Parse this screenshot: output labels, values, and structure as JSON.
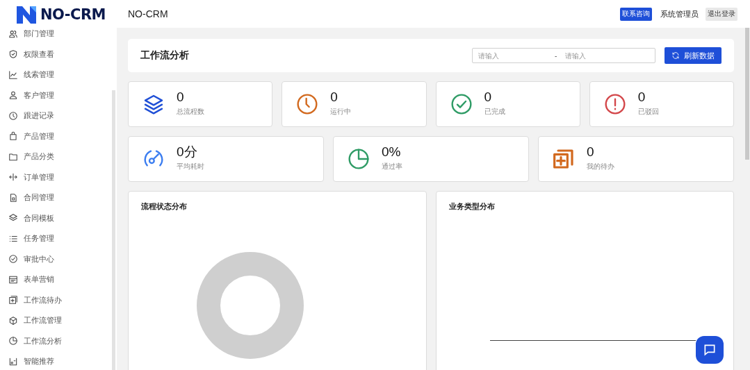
{
  "brand": {
    "logo_text": "NO-CRM"
  },
  "header": {
    "title": "NO-CRM",
    "contact_button": "联系咨询",
    "user": "系统管理员",
    "logout_button": "退出登录"
  },
  "sidebar": {
    "items": [
      {
        "label": "部门管理"
      },
      {
        "label": "权限查看"
      },
      {
        "label": "线索管理"
      },
      {
        "label": "客户管理"
      },
      {
        "label": "跟进记录"
      },
      {
        "label": "产品管理"
      },
      {
        "label": "产品分类"
      },
      {
        "label": "订单管理"
      },
      {
        "label": "合同管理"
      },
      {
        "label": "合同模板"
      },
      {
        "label": "任务管理"
      },
      {
        "label": "审批中心"
      },
      {
        "label": "表单营销"
      },
      {
        "label": "工作流待办"
      },
      {
        "label": "工作流管理"
      },
      {
        "label": "工作流分析"
      },
      {
        "label": "智能推荐"
      }
    ]
  },
  "page": {
    "title": "工作流分析",
    "date_range": {
      "start_placeholder": "请输入",
      "separator": "-",
      "end_placeholder": "请输入"
    },
    "refresh_button": "刷新数据"
  },
  "stat_rows": [
    [
      {
        "value": "0",
        "label": "总流程数"
      },
      {
        "value": "0",
        "label": "运行中"
      },
      {
        "value": "0",
        "label": "已完成"
      },
      {
        "value": "0",
        "label": "已驳回"
      }
    ],
    [
      {
        "value": "0分",
        "label": "平均耗时"
      },
      {
        "value": "0%",
        "label": "通过率"
      },
      {
        "value": "0",
        "label": "我的待办"
      }
    ]
  ],
  "charts": [
    {
      "title": "流程状态分布",
      "kind": "donut"
    },
    {
      "title": "业务类型分布",
      "kind": "axis"
    }
  ]
}
